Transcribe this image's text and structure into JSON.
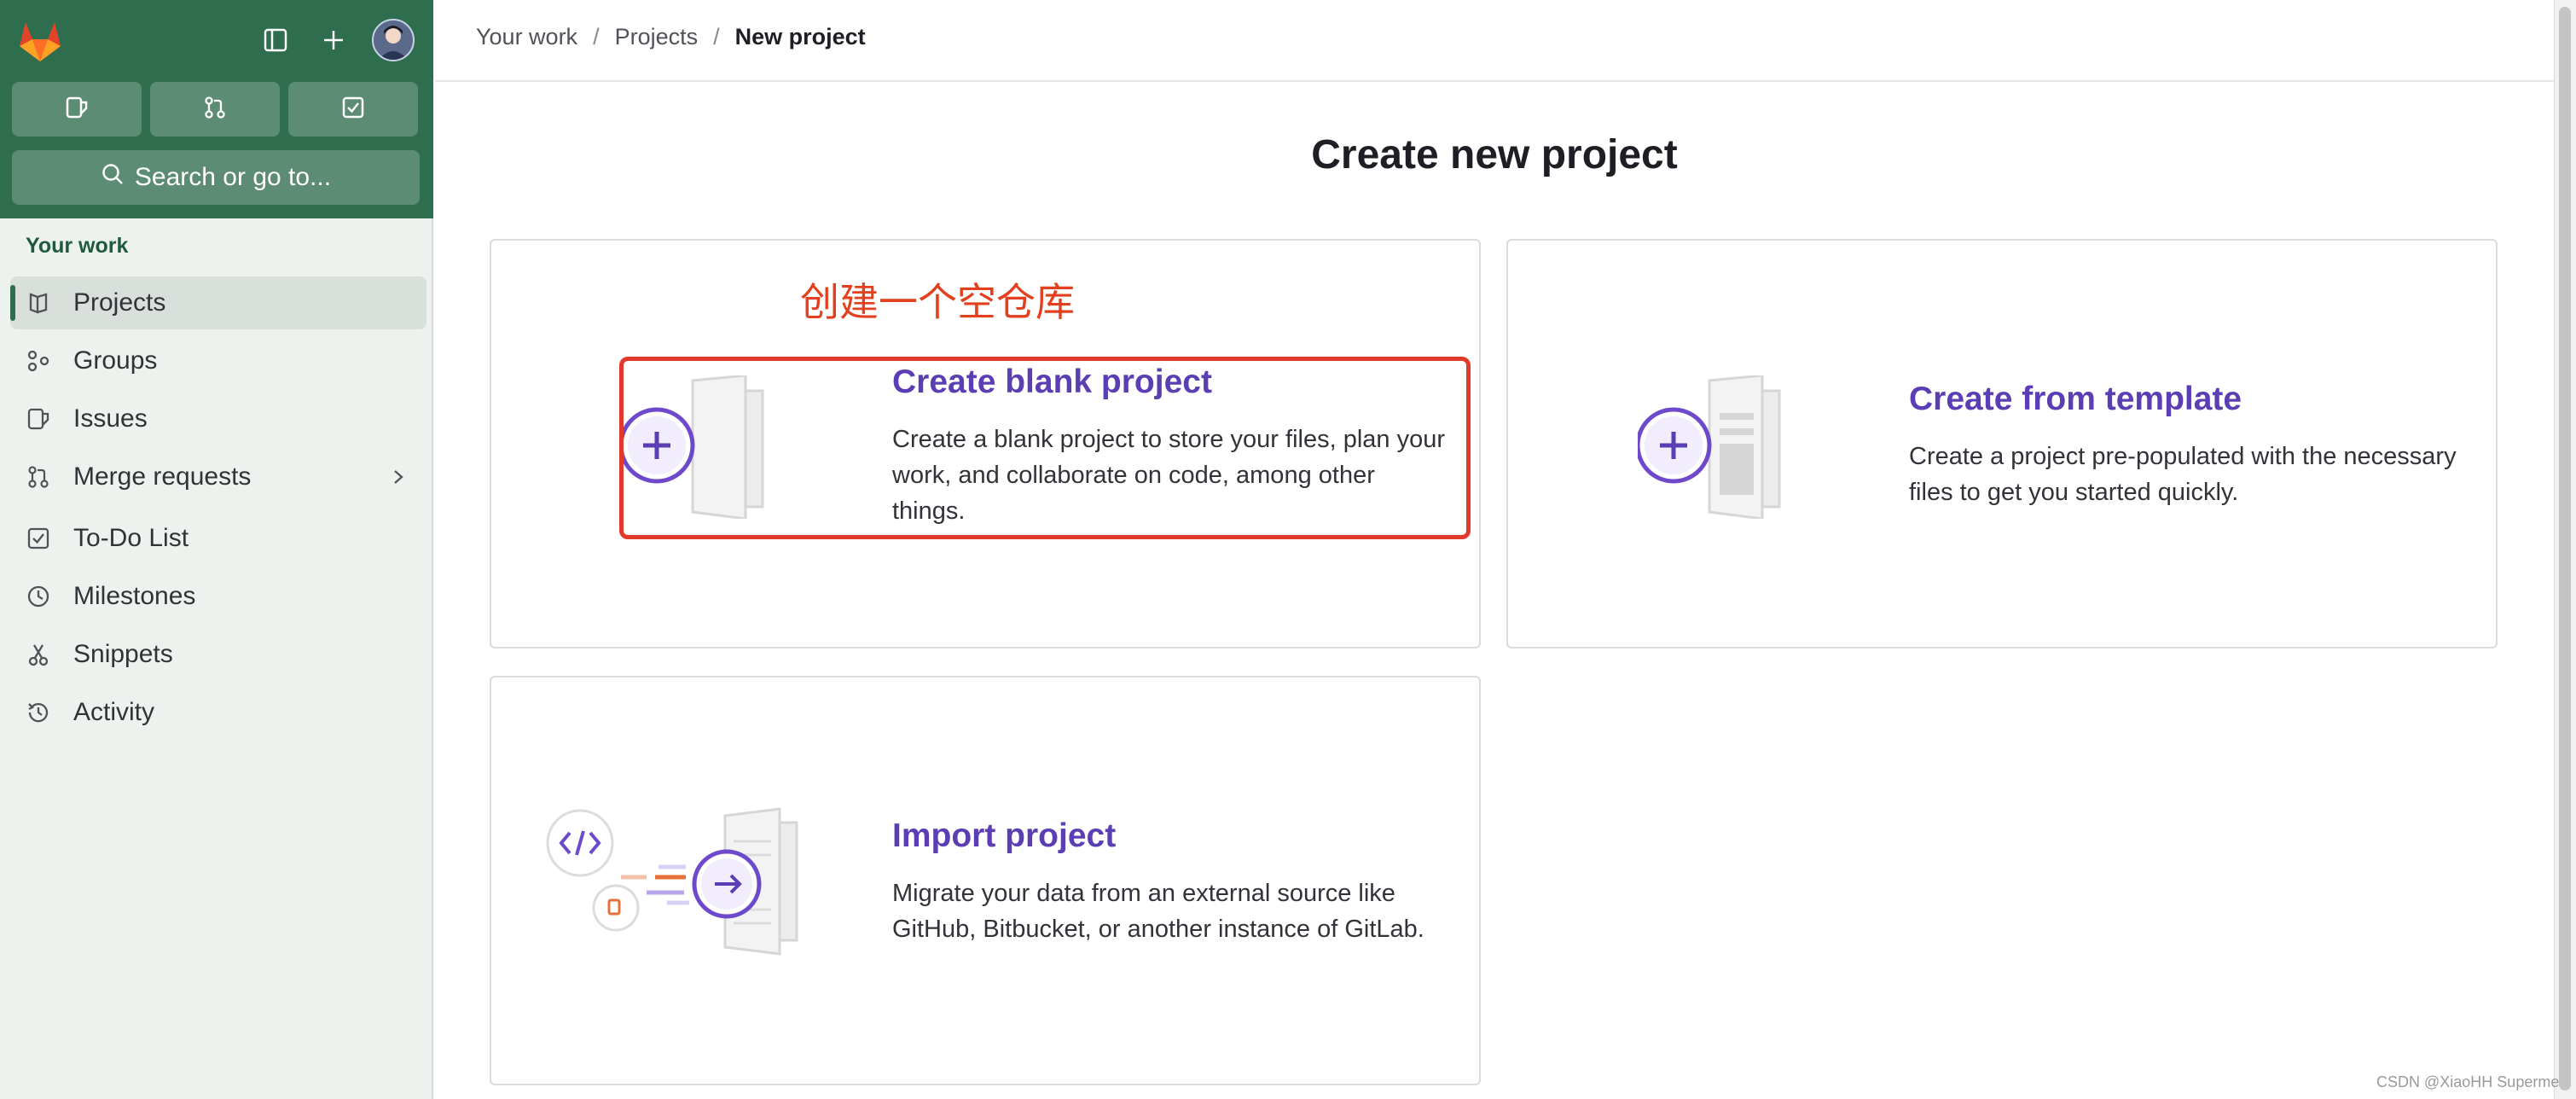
{
  "colors": {
    "sidebar_top": "#2f6d4f",
    "sidebar_bg": "#eef2ef",
    "accent_purple": "#5b3eb3",
    "annotation_red": "#e2401f"
  },
  "sidebar": {
    "section_title": "Your work",
    "search_placeholder": "Search or go to...",
    "quick_icons": [
      "issues-icon",
      "merge-request-icon",
      "todo-icon"
    ],
    "top_icons": [
      "gitlab-logo",
      "sidebar-toggle-icon",
      "plus-icon",
      "avatar"
    ],
    "items": [
      {
        "label": "Projects",
        "icon": "project-icon",
        "active": true
      },
      {
        "label": "Groups",
        "icon": "group-icon"
      },
      {
        "label": "Issues",
        "icon": "issues-icon"
      },
      {
        "label": "Merge requests",
        "icon": "merge-request-icon",
        "has_chevron": true
      },
      {
        "label": "To-Do List",
        "icon": "todo-icon"
      },
      {
        "label": "Milestones",
        "icon": "clock-icon"
      },
      {
        "label": "Snippets",
        "icon": "snippet-icon"
      },
      {
        "label": "Activity",
        "icon": "history-icon"
      }
    ]
  },
  "breadcrumb": {
    "items": [
      "Your work",
      "Projects",
      "New project"
    ],
    "separator": "/"
  },
  "page": {
    "title": "Create new project"
  },
  "cards": {
    "blank": {
      "title": "Create blank project",
      "desc_lines": [
        "Create a blank project to store your files, plan your",
        "work, and collaborate on code, among other",
        "things."
      ]
    },
    "template": {
      "title": "Create from template",
      "desc_lines": [
        "Create a project pre-populated with the necessary",
        "files to get you started quickly."
      ]
    },
    "import": {
      "title": "Import project",
      "desc_lines": [
        "Migrate your data from an external source like",
        "GitHub, Bitbucket, or another instance of GitLab."
      ]
    }
  },
  "annotation": {
    "text": "创建一个空仓库"
  },
  "watermark": "CSDN @XiaoHH Superme"
}
